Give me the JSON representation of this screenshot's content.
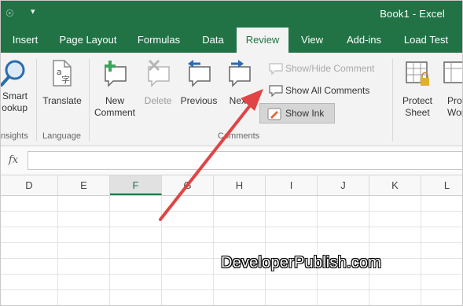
{
  "window": {
    "title": "Book1  -  Excel",
    "qat_icon": "touch-mode-icon",
    "qat_dropdown": "▾"
  },
  "tabs": [
    {
      "label": "Insert"
    },
    {
      "label": "Page Layout"
    },
    {
      "label": "Formulas"
    },
    {
      "label": "Data"
    },
    {
      "label": "Review",
      "active": true
    },
    {
      "label": "View"
    },
    {
      "label": "Add-ins"
    },
    {
      "label": "Load Test"
    }
  ],
  "ribbon": {
    "smart_lookup": {
      "line1": "Smart",
      "line2": "ookup",
      "icon": "search-icon"
    },
    "insights_group": "nsights",
    "translate": {
      "label": "Translate",
      "icon": "translate-icon"
    },
    "language_group": "Language",
    "new_comment": {
      "line1": "New",
      "line2": "Comment",
      "icon": "new-comment-icon"
    },
    "delete": {
      "label": "Delete",
      "icon": "delete-comment-icon"
    },
    "previous": {
      "label": "Previous",
      "icon": "previous-comment-icon"
    },
    "next": {
      "label": "Next",
      "icon": "next-comment-icon"
    },
    "show_hide_comment": {
      "label": "Show/Hide Comment",
      "icon": "show-hide-comment-icon"
    },
    "show_all_comments": {
      "label": "Show All Comments",
      "icon": "show-all-comments-icon"
    },
    "show_ink": {
      "label": "Show Ink",
      "icon": "show-ink-icon"
    },
    "comments_group": "Comments",
    "protect_sheet": {
      "line1": "Protect",
      "line2": "Sheet",
      "icon": "protect-sheet-icon"
    },
    "protect_workbook": {
      "line1": "Pro",
      "line2": "Work",
      "icon": "protect-workbook-icon"
    }
  },
  "formula_bar": {
    "fx_label": "fx",
    "value": ""
  },
  "columns": [
    "D",
    "E",
    "F",
    "G",
    "H",
    "I",
    "J",
    "K",
    "L"
  ],
  "selected_column": "F",
  "watermark": "DeveloperPublish.com",
  "colors": {
    "brand": "#217346",
    "arrow": "#e04444",
    "ribbon_bg": "#f3f3f3"
  }
}
